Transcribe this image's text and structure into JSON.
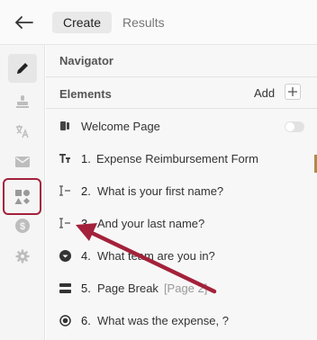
{
  "header": {
    "tabs": [
      {
        "label": "Create",
        "active": true
      },
      {
        "label": "Results",
        "active": false
      }
    ]
  },
  "rail": {
    "items": [
      {
        "name": "pencil-icon",
        "active": true
      },
      {
        "name": "stamp-icon"
      },
      {
        "name": "translate-icon"
      },
      {
        "name": "mail-icon"
      },
      {
        "name": "shapes-icon",
        "highlighted": true
      },
      {
        "name": "dollar-icon"
      },
      {
        "name": "gear-icon"
      }
    ]
  },
  "navigator": {
    "title": "Navigator"
  },
  "elements": {
    "title": "Elements",
    "add_label": "Add",
    "items": [
      {
        "icon": "welcome-page-icon",
        "number": "",
        "label": "Welcome Page",
        "toggle": false
      },
      {
        "icon": "text-format-icon",
        "number": "1.",
        "label": "Expense Reimbursement Form"
      },
      {
        "icon": "text-input-icon",
        "number": "2.",
        "label": "What is your first name?"
      },
      {
        "icon": "text-input-icon",
        "number": "3.",
        "label": "And your last name?"
      },
      {
        "icon": "dropdown-icon",
        "number": "4.",
        "label": "What team are you in?"
      },
      {
        "icon": "page-break-icon",
        "number": "5.",
        "label": "Page Break",
        "tag": "[Page 2]"
      },
      {
        "icon": "radio-icon",
        "number": "6.",
        "label": "What was the expense, ?"
      }
    ]
  },
  "colors": {
    "highlight": "#a3213a",
    "arrow": "#a3213a"
  }
}
